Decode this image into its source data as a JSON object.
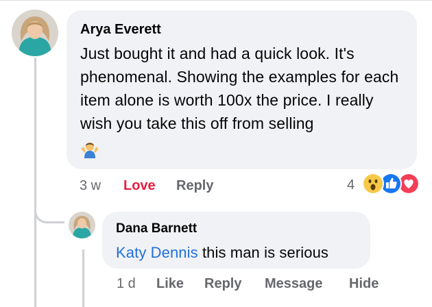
{
  "comment": {
    "author": "Arya Everett",
    "text": "Just bought it and had a quick look. It's phenomenal. Showing the examples for each item alone is worth 100x the price. I really wish you take this off from selling",
    "emoji_icon": "person-shrugging-emoji",
    "actions": {
      "time": "3 w",
      "love_label": "Love",
      "reply_label": "Reply"
    },
    "reactions": {
      "count": "4",
      "icons": [
        "wow-reaction-icon",
        "like-reaction-icon",
        "love-reaction-icon"
      ]
    }
  },
  "reply": {
    "author": "Dana Barnett",
    "mention": "Katy Dennis",
    "text": "this man is serious",
    "actions": {
      "time": "1 d",
      "like_label": "Like",
      "reply_label": "Reply",
      "message_label": "Message",
      "hide_label": "Hide"
    }
  },
  "colors": {
    "bubble": "#f0f2f5",
    "secondary_text": "#65676b",
    "love": "#e41e3f",
    "mention": "#216fdb",
    "like_blue": "#1877f2"
  }
}
